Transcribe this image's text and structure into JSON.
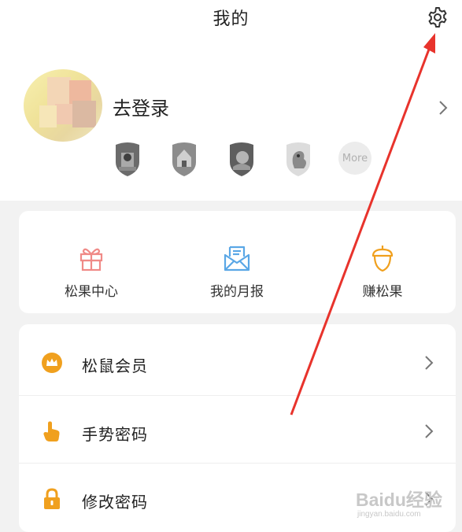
{
  "header": {
    "title": "我的",
    "settings_icon": "gear-icon"
  },
  "profile": {
    "login_label": "去登录",
    "more_label": "More",
    "badges": [
      "shield-badge-1",
      "shield-badge-2",
      "shield-badge-3",
      "shield-badge-4"
    ]
  },
  "quick_actions": [
    {
      "label": "松果中心",
      "icon": "gift-icon",
      "color": "#f08a87"
    },
    {
      "label": "我的月报",
      "icon": "envelope-icon",
      "color": "#5aa7e6"
    },
    {
      "label": "赚松果",
      "icon": "acorn-icon",
      "color": "#f0a01e"
    }
  ],
  "menu": [
    {
      "label": "松鼠会员",
      "icon": "crown-icon"
    },
    {
      "label": "手势密码",
      "icon": "hand-icon"
    },
    {
      "label": "修改密码",
      "icon": "lock-icon"
    }
  ],
  "watermark": {
    "main": "Baidu经验",
    "sub": "jingyan.baidu.com"
  },
  "colors": {
    "accent_orange": "#f0a01e",
    "annotation_red": "#e8332c",
    "background": "#f2f2f2"
  }
}
